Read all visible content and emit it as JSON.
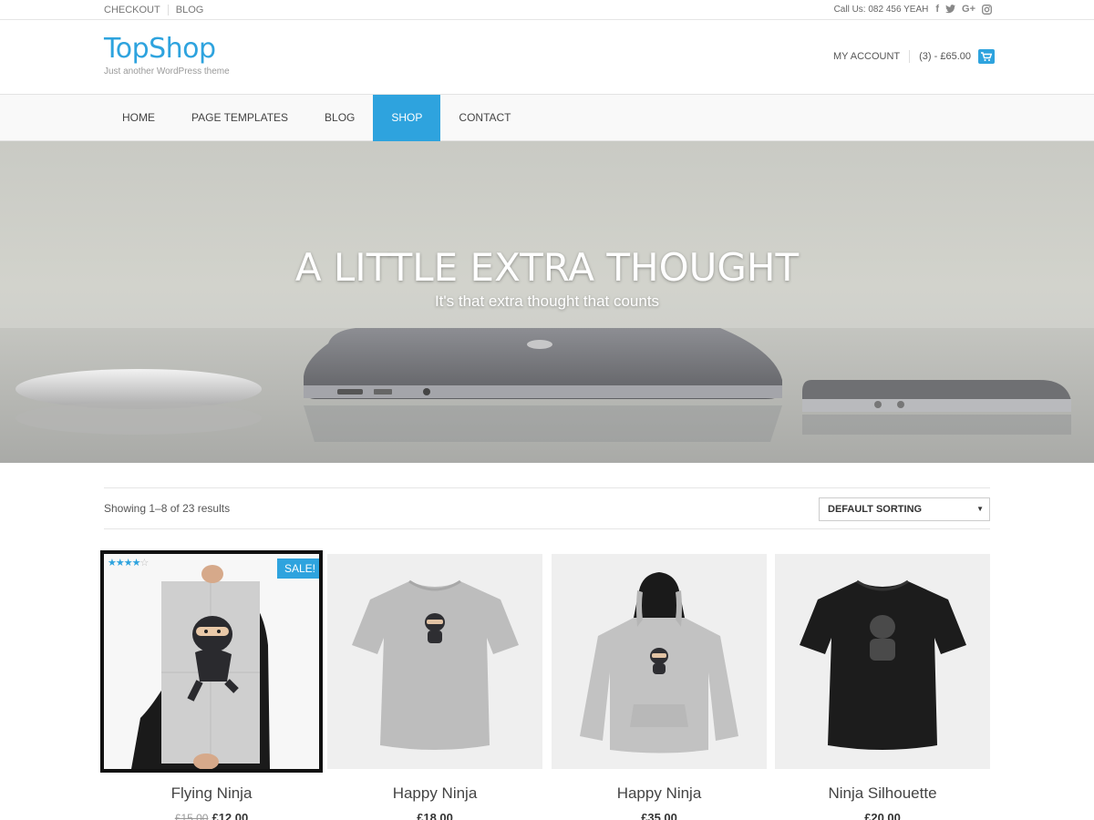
{
  "topbar": {
    "links": [
      "CHECKOUT",
      "BLOG"
    ],
    "phone": "Call Us: 082 456 YEAH",
    "social_icons": [
      "facebook-icon",
      "twitter-icon",
      "google-plus-icon",
      "instagram-icon"
    ]
  },
  "header": {
    "site_title": "TopShop",
    "tagline": "Just another WordPress theme",
    "account_label": "MY ACCOUNT",
    "cart_summary": "(3) - £65.00",
    "cart_icon": "shopping-cart-icon"
  },
  "nav": {
    "items": [
      "HOME",
      "PAGE TEMPLATES",
      "BLOG",
      "SHOP",
      "CONTACT"
    ],
    "active": "SHOP"
  },
  "hero": {
    "headline": "A LITTLE EXTRA THOUGHT",
    "subheadline": "It's that extra thought that counts"
  },
  "results": {
    "count_text": "Showing 1–8 of 23 results",
    "sort_selected": "DEFAULT SORTING"
  },
  "products": [
    {
      "name": "Flying Ninja",
      "old_price": "£15.00",
      "price": "£12.00",
      "sale_badge": "SALE!",
      "rating": 4
    },
    {
      "name": "Happy Ninja",
      "price": "£18.00"
    },
    {
      "name": "Happy Ninja",
      "price": "£35.00"
    },
    {
      "name": "Ninja Silhouette",
      "price": "£20.00"
    }
  ],
  "colors": {
    "accent": "#2ea3de"
  }
}
